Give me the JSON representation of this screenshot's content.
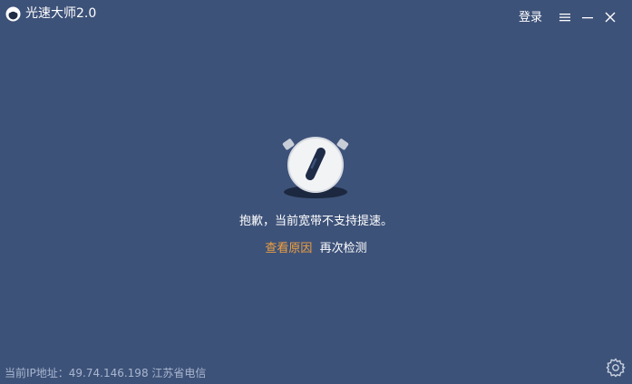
{
  "window": {
    "title": "光速大师2.0",
    "login_label": "登录"
  },
  "status": {
    "message": "抱歉，当前宽带不支持提速。",
    "view_reason_label": "查看原因",
    "recheck_label": "再次检测"
  },
  "footer": {
    "ip_label": "当前IP地址：",
    "ip_address": "49.74.146.198",
    "isp": "江苏省电信"
  },
  "icons": {
    "logo": "app-logo-icon",
    "menu": "hamburger-menu-icon",
    "minimize": "minimize-icon",
    "close": "close-icon",
    "status": "broken-speedometer-icon",
    "settings": "gear-icon"
  },
  "colors": {
    "background": "#3d5279",
    "accent_link": "#f0a040",
    "footer_text": "#a9b6cf"
  }
}
